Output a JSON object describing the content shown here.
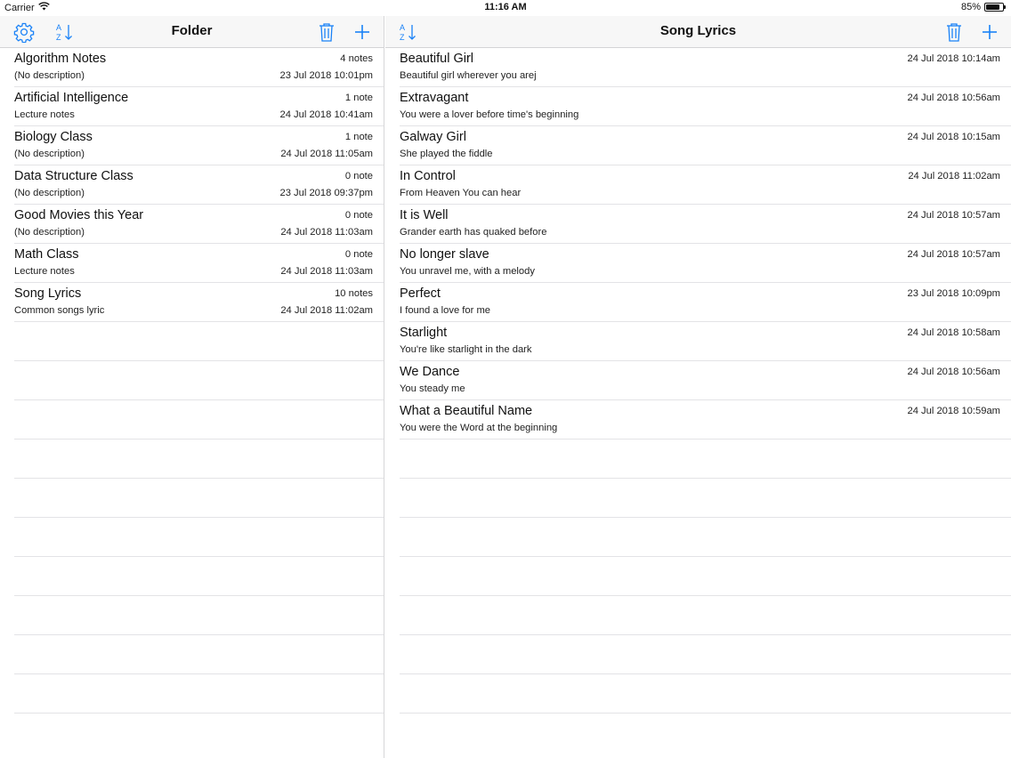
{
  "status_bar": {
    "carrier": "Carrier",
    "time": "11:16 AM",
    "battery_percent": "85%",
    "battery_level": 0.85
  },
  "colors": {
    "accent": "#1a82f7"
  },
  "folder_pane": {
    "title": "Folder",
    "icons": [
      "gear-icon",
      "sort-az-icon",
      "trash-icon",
      "plus-icon"
    ],
    "folders": [
      {
        "name": "Algorithm Notes",
        "description": "(No description)",
        "count": "4 notes",
        "date": "23 Jul 2018 10:01pm"
      },
      {
        "name": "Artificial Intelligence",
        "description": "Lecture notes",
        "count": "1 note",
        "date": "24 Jul 2018 10:41am"
      },
      {
        "name": "Biology Class",
        "description": "(No description)",
        "count": "1 note",
        "date": "24 Jul 2018 11:05am"
      },
      {
        "name": "Data Structure Class",
        "description": "(No description)",
        "count": "0 note",
        "date": "23 Jul 2018 09:37pm"
      },
      {
        "name": "Good Movies this Year",
        "description": "(No description)",
        "count": "0 note",
        "date": "24 Jul 2018 11:03am"
      },
      {
        "name": "Math Class",
        "description": "Lecture notes",
        "count": "0 note",
        "date": "24 Jul 2018 11:03am"
      },
      {
        "name": "Song Lyrics",
        "description": "Common songs lyric",
        "count": "10 notes",
        "date": "24 Jul 2018 11:02am"
      }
    ]
  },
  "notes_pane": {
    "title": "Song Lyrics",
    "icons": [
      "sort-az-icon",
      "trash-icon",
      "plus-icon"
    ],
    "notes": [
      {
        "title": "Beautiful Girl",
        "preview": "Beautiful girl wherever you arej",
        "date": "24 Jul 2018 10:14am"
      },
      {
        "title": "Extravagant",
        "preview": "You were a lover before time's beginning",
        "date": "24 Jul 2018 10:56am"
      },
      {
        "title": "Galway Girl",
        "preview": "She played the fiddle",
        "date": "24 Jul 2018 10:15am"
      },
      {
        "title": "In Control",
        "preview": "From Heaven You can hear",
        "date": "24 Jul 2018 11:02am"
      },
      {
        "title": "It is Well",
        "preview": "Grander earth has quaked before",
        "date": "24 Jul 2018 10:57am"
      },
      {
        "title": "No longer slave",
        "preview": "You unravel me, with a melody",
        "date": "24 Jul 2018 10:57am"
      },
      {
        "title": "Perfect",
        "preview": "I found a love for me",
        "date": "23 Jul 2018 10:09pm"
      },
      {
        "title": "Starlight",
        "preview": "You're like starlight in the dark",
        "date": "24 Jul 2018 10:58am"
      },
      {
        "title": "We Dance",
        "preview": "You steady me",
        "date": "24 Jul 2018 10:56am"
      },
      {
        "title": "What a Beautiful Name",
        "preview": "You were the Word at the beginning",
        "date": "24 Jul 2018 10:59am"
      }
    ]
  }
}
